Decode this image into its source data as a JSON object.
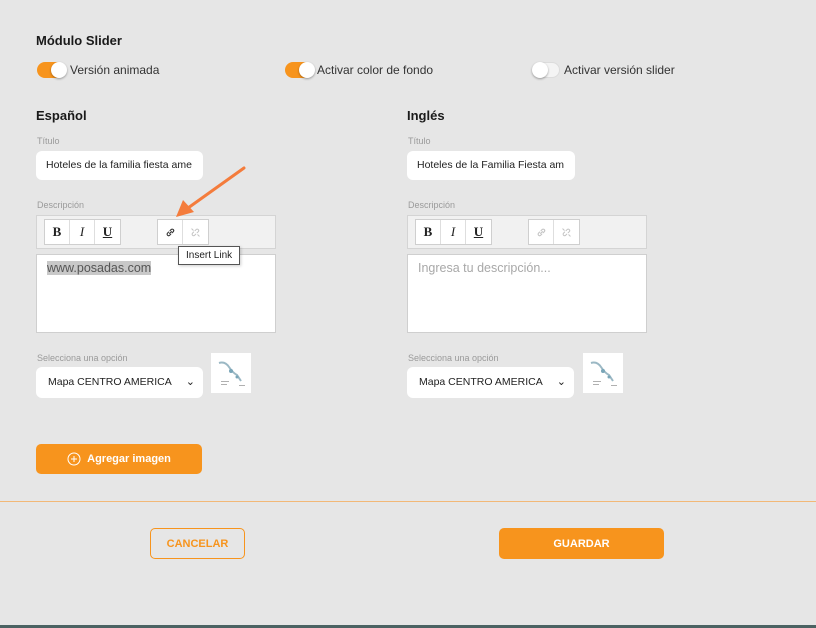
{
  "module": {
    "title": "Módulo Slider"
  },
  "toggles": [
    {
      "label": "Versión animada",
      "on": true
    },
    {
      "label": "Activar color de fondo",
      "on": true
    },
    {
      "label": "Activar versión slider",
      "on": false
    }
  ],
  "spanish": {
    "heading": "Español",
    "title_label": "Título",
    "title_value": "Hoteles de la familia fiesta ame",
    "description_label": "Descripción",
    "description_value": "www.posadas.com",
    "select_label": "Selecciona una opción",
    "select_value": "Mapa CENTRO AMERICA"
  },
  "english": {
    "heading": "Inglés",
    "title_label": "Título",
    "title_value": "Hoteles de la Familia Fiesta am",
    "description_label": "Descripción",
    "description_placeholder": "Ingresa tu descripción...",
    "select_label": "Selecciona una opción",
    "select_value": "Mapa CENTRO AMERICA"
  },
  "toolbar": {
    "bold": "B",
    "italic": "I",
    "underline": "U"
  },
  "tooltip": "Insert Link",
  "add_image": "Agregar imagen",
  "cancel": "CANCELAR",
  "save": "GUARDAR",
  "colors": {
    "accent": "#f7941d",
    "background": "#e6e6e6",
    "annotation_arrow": "#f47c3c"
  }
}
